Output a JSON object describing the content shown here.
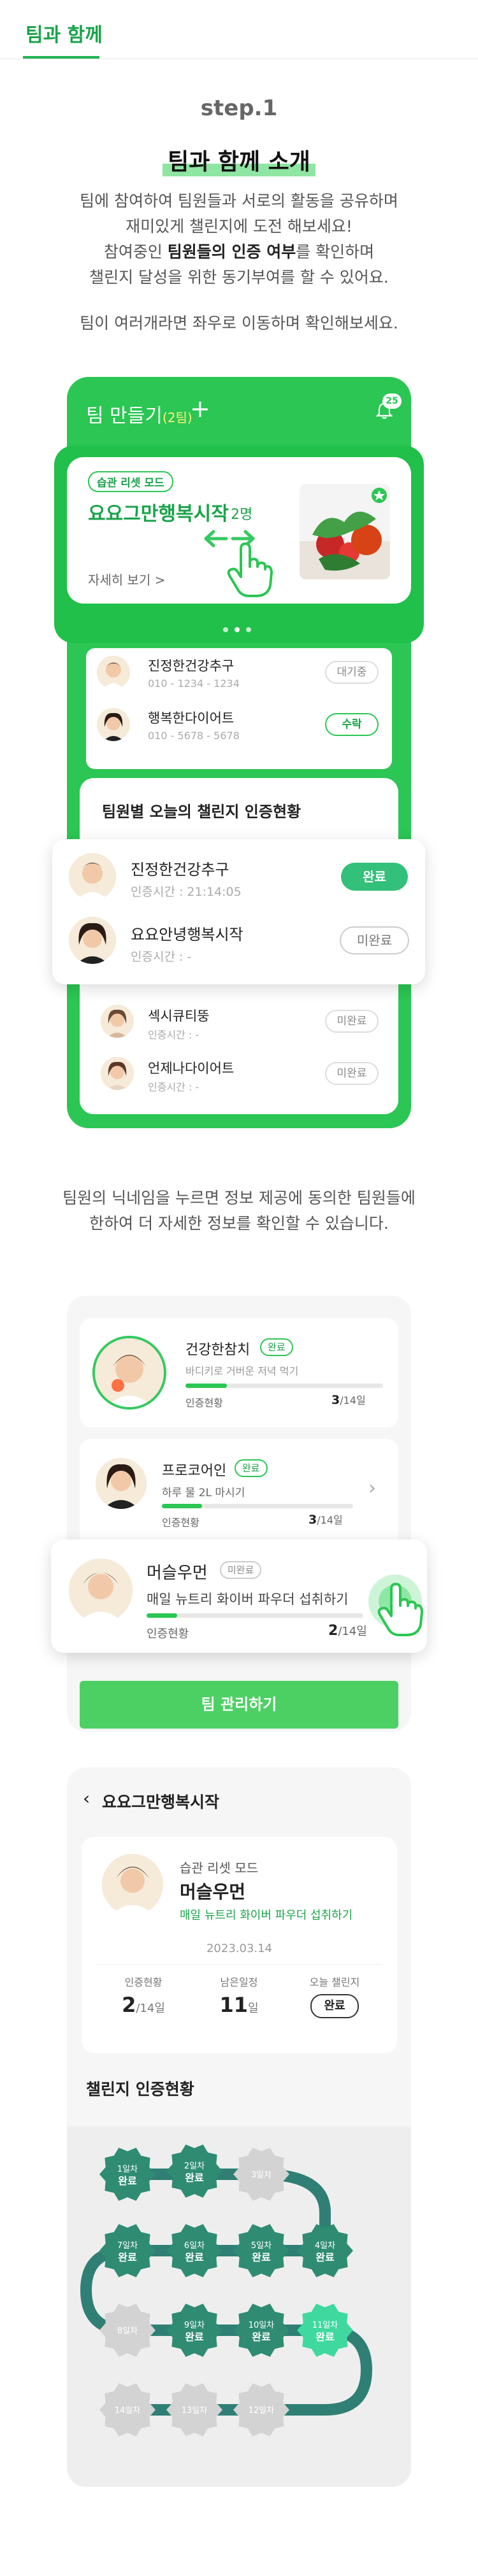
{
  "header": {
    "tab_label": "팀과 함께"
  },
  "intro": {
    "step": "step.1",
    "title": "팀과 함께 소개",
    "lines": [
      {
        "pre": "팀에 참여하여 팀원들과 서로의 활동을 공유하며",
        "bold": "",
        "post": ""
      },
      {
        "pre": "재미있게 챌린지에 도전 해보세요!",
        "bold": "",
        "post": ""
      },
      {
        "pre": "참여중인 ",
        "bold": "팀원들의 인증 여부",
        "post": "를 확인하며"
      },
      {
        "pre": "챌린지 달성을 위한 동기부여를 할 수 있어요.",
        "bold": "",
        "post": ""
      }
    ],
    "swipe_hint": "팀이 여러개라면 좌우로 이동하며 확인해보세요."
  },
  "team_screen": {
    "header_title": "팀 만들기",
    "header_sub": "(2팀)",
    "plus": "+",
    "bell_badge": "25",
    "team_card": {
      "chip": "습관 리셋 모드",
      "name": "요요그만행복시작",
      "count": "2명",
      "more": "자세히 보기 >"
    },
    "members": [
      {
        "name": "진정한건강추구",
        "phone": "010 - 1234 - 1234",
        "status": "대기중",
        "green": false
      },
      {
        "name": "행복한다이어트",
        "phone": "010 - 5678 - 5678",
        "status": "수락",
        "green": true
      }
    ],
    "status_title": "팀원별 오늘의 챌린지 인증현황",
    "status_popup": [
      {
        "name": "진정한건강추구",
        "time": "인증시간 : 21:14:05",
        "status": "완료",
        "done": true
      },
      {
        "name": "요요안녕행복시작",
        "time": "인증시간 : -",
        "status": "미완료",
        "done": false
      }
    ],
    "status_rest": [
      {
        "name": "섹시큐티뚱",
        "time": "인증시간 : -",
        "status": "미완료"
      },
      {
        "name": "언제나다이어트",
        "time": "인증시간 : -",
        "status": "미완료"
      }
    ]
  },
  "nickname_note": [
    "팀원의 닉네임을 누르면 정보 제공에 동의한 팀원들에",
    "한하여 더 자세한 정보를 확인할 수 있습니다."
  ],
  "member_list": {
    "members": [
      {
        "name": "건강한참치",
        "tag": "완료",
        "goal": "바디키로 거버운 저녁 먹기",
        "progress_label": "인증현황",
        "progress": "3",
        "total": "/14일",
        "fraction": 0.21
      },
      {
        "name": "프로코어인",
        "tag": "완료",
        "goal": "하루 물 2L 마시기",
        "progress_label": "인증현황",
        "progress": "3",
        "total": "/14일",
        "fraction": 0.21
      },
      {
        "name": "머슬우먼",
        "tag": "미완료",
        "goal": "매일 뉴트리 화이버 파우더 섭취하기",
        "progress_label": "인증현황",
        "progress": "2",
        "total": "/14일",
        "fraction": 0.14
      }
    ],
    "manage_button": "팀 관리하기"
  },
  "detail": {
    "back_title": "요요그만행복시작",
    "mode": "습관 리셋 모드",
    "name": "머슬우먼",
    "goal": "매일 뉴트리 화이버 파우더 섭취하기",
    "date": "2023.03.14",
    "stats": [
      {
        "label": "인증현황",
        "value": "2",
        "unit": "/14일"
      },
      {
        "label": "남은일정",
        "value": "11",
        "unit": "일"
      },
      {
        "label": "오늘 챌린지",
        "value": "완료",
        "unit": ""
      }
    ],
    "board_title": "챌린지 인증현황",
    "days": [
      {
        "day": "1일차",
        "state": "완료",
        "kind": "done"
      },
      {
        "day": "2일차",
        "state": "완료",
        "kind": "done"
      },
      {
        "day": "3일차",
        "state": "",
        "kind": "pending"
      },
      {
        "day": "4일차",
        "state": "완료",
        "kind": "done"
      },
      {
        "day": "5일차",
        "state": "완료",
        "kind": "done"
      },
      {
        "day": "6일차",
        "state": "완료",
        "kind": "done"
      },
      {
        "day": "7일차",
        "state": "완료",
        "kind": "done"
      },
      {
        "day": "8일차",
        "state": "",
        "kind": "pending"
      },
      {
        "day": "9일차",
        "state": "완료",
        "kind": "done"
      },
      {
        "day": "10일차",
        "state": "완료",
        "kind": "done"
      },
      {
        "day": "11일차",
        "state": "완료",
        "kind": "today"
      },
      {
        "day": "12일차",
        "state": "",
        "kind": "pending"
      },
      {
        "day": "13일차",
        "state": "",
        "kind": "pending"
      },
      {
        "day": "14일차",
        "state": "",
        "kind": "pending"
      }
    ]
  },
  "colors": {
    "brand": "#2bc653",
    "brand_dark": "#1aa34a",
    "done_gear": "#2f8c73",
    "today_gear": "#3fd9a0",
    "pending_gear": "#d3d3d3"
  }
}
